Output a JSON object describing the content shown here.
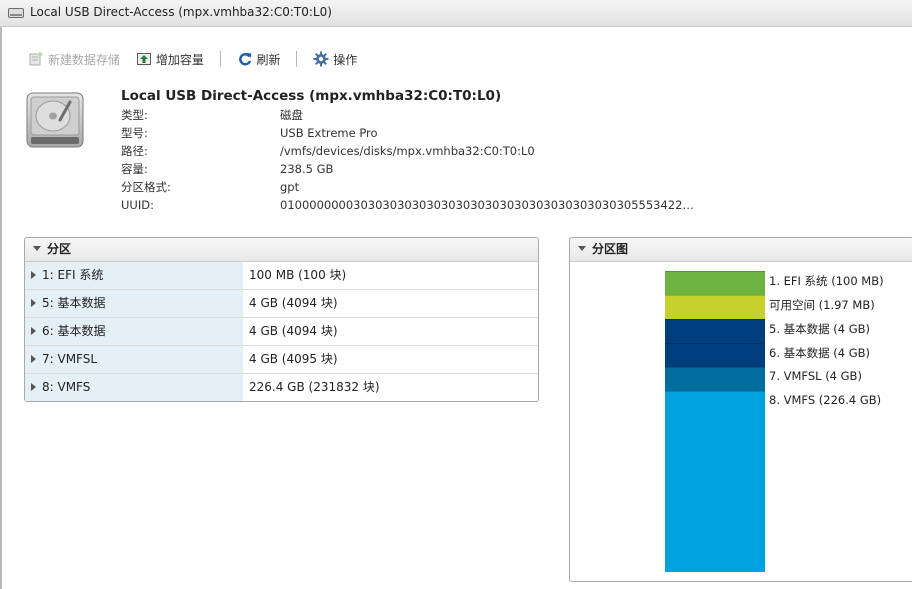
{
  "window": {
    "title": "Local USB Direct-Access (mpx.vmhba32:C0:T0:L0)"
  },
  "toolbar": {
    "new_datastore": "新建数据存储",
    "increase_capacity": "增加容量",
    "refresh": "刷新",
    "actions": "操作"
  },
  "disk": {
    "title": "Local USB Direct-Access (mpx.vmhba32:C0:T0:L0)",
    "properties": [
      {
        "label": "类型:",
        "value": "磁盘"
      },
      {
        "label": "型号:",
        "value": "USB Extreme Pro"
      },
      {
        "label": "路径:",
        "value": "/vmfs/devices/disks/mpx.vmhba32:C0:T0:L0"
      },
      {
        "label": "容量:",
        "value": "238.5 GB"
      },
      {
        "label": "分区格式:",
        "value": "gpt"
      },
      {
        "label": "UUID:",
        "value": "0100000000303030303030303030303030303030303030305553422…"
      }
    ]
  },
  "partitions_panel": {
    "title": "分区",
    "rows": [
      {
        "name": "1: EFI 系统",
        "size": "100 MB (100 块)"
      },
      {
        "name": "5: 基本数据",
        "size": "4 GB (4094 块)"
      },
      {
        "name": "6: 基本数据",
        "size": "4 GB (4094 块)"
      },
      {
        "name": "7: VMFSL",
        "size": "4 GB (4095 块)"
      },
      {
        "name": "8: VMFS",
        "size": "226.4 GB (231832 块)"
      }
    ]
  },
  "map_panel": {
    "title": "分区图",
    "segments": [
      {
        "label": "1. EFI 系统 (100 MB)",
        "color": "#6db33f"
      },
      {
        "label": "可用空间 (1.97 MB)",
        "color": "#c6d22c"
      },
      {
        "label": "5. 基本数据 (4 GB)",
        "color": "#003d7d"
      },
      {
        "label": "6. 基本数据 (4 GB)",
        "color": "#003d7d"
      },
      {
        "label": "7. VMFSL (4 GB)",
        "color": "#006d9c"
      },
      {
        "label": "8. VMFS (226.4 GB)",
        "color": "#00a1dd"
      }
    ]
  }
}
